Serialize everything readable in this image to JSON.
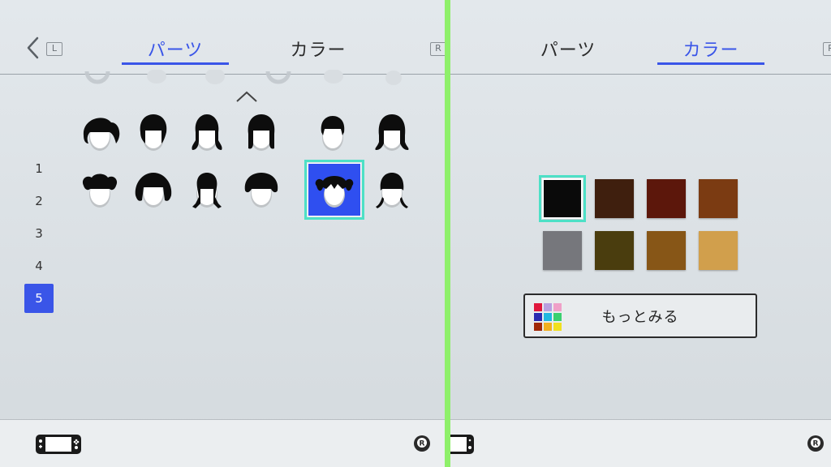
{
  "left_pane": {
    "tabs": [
      {
        "label": "パーツ",
        "active": true
      },
      {
        "label": "カラー",
        "active": false
      }
    ],
    "left_button_hint": "L",
    "right_button_hint": "R",
    "page_numbers": [
      {
        "label": "1",
        "active": false
      },
      {
        "label": "2",
        "active": false
      },
      {
        "label": "3",
        "active": false
      },
      {
        "label": "4",
        "active": false
      },
      {
        "label": "5",
        "active": true
      }
    ],
    "hairstyles": [
      {
        "style": "side-ponytail",
        "selected": false
      },
      {
        "style": "bun-top",
        "selected": false
      },
      {
        "style": "low-pigtails",
        "selected": false
      },
      {
        "style": "long-straight",
        "selected": false
      },
      {
        "style": "short-bob",
        "selected": false
      },
      {
        "style": "bangs-shoulder",
        "selected": false
      },
      {
        "style": "twin-buns",
        "selected": false
      },
      {
        "style": "wide-pigtails",
        "selected": false
      },
      {
        "style": "twin-braids",
        "selected": false
      },
      {
        "style": "rounded-top",
        "selected": false
      },
      {
        "style": "high-pigtails",
        "selected": true
      },
      {
        "style": "bangs-braids",
        "selected": false
      }
    ],
    "footer_icon": "switch-console-icon",
    "footer_right_icon": "right-stick-icon"
  },
  "right_pane": {
    "tabs": [
      {
        "label": "パーツ",
        "active": false
      },
      {
        "label": "カラー",
        "active": true
      }
    ],
    "right_button_hint": "R",
    "colors": [
      {
        "hex": "#0a0a0a",
        "selected": true
      },
      {
        "hex": "#3f1f0e",
        "selected": false
      },
      {
        "hex": "#5c170b",
        "selected": false
      },
      {
        "hex": "#7b3b12",
        "selected": false
      },
      {
        "hex": "#76777c",
        "selected": false
      },
      {
        "hex": "#4a3d0e",
        "selected": false
      },
      {
        "hex": "#875617",
        "selected": false
      },
      {
        "hex": "#d19f4c",
        "selected": false
      }
    ],
    "more_button_label": "もっとみる",
    "more_icon_colors": [
      "#e0173c",
      "#b8a0e0",
      "#f0a0c8",
      "#2a2ab0",
      "#20b8e0",
      "#3ad070",
      "#a02808",
      "#f0b020",
      "#f0e020"
    ],
    "footer_icon": "switch-console-icon",
    "footer_right_icon": "right-stick-icon"
  },
  "colors": {
    "accent": "#3a55e8",
    "selection_outline": "#4de0c6",
    "divider": "#8ef06a"
  }
}
